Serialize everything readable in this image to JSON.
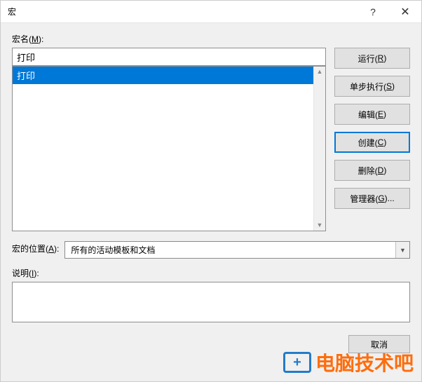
{
  "window": {
    "title": "宏",
    "help_symbol": "?",
    "close_symbol": "✕"
  },
  "labels": {
    "macro_name_prefix": "宏名(",
    "macro_name_key": "M",
    "macro_name_suffix": "):",
    "location_prefix": "宏的位置(",
    "location_key": "A",
    "location_suffix": "):",
    "description_prefix": "说明(",
    "description_key": "I",
    "description_suffix": "):"
  },
  "macro": {
    "name_value": "打印",
    "list": [
      "打印"
    ]
  },
  "location": {
    "selected": "所有的活动模板和文档"
  },
  "buttons": {
    "run": {
      "prefix": "运行(",
      "key": "R",
      "suffix": ")"
    },
    "step": {
      "prefix": "单步执行(",
      "key": "S",
      "suffix": ")"
    },
    "edit": {
      "prefix": "编辑(",
      "key": "E",
      "suffix": ")"
    },
    "create": {
      "prefix": "创建(",
      "key": "C",
      "suffix": ")"
    },
    "delete": {
      "prefix": "删除(",
      "key": "D",
      "suffix": ")"
    },
    "organizer": {
      "prefix": "管理器(",
      "key": "G",
      "suffix": ")..."
    }
  },
  "footer": {
    "cancel": "取消"
  },
  "watermark": {
    "text": "电脑技术吧"
  }
}
